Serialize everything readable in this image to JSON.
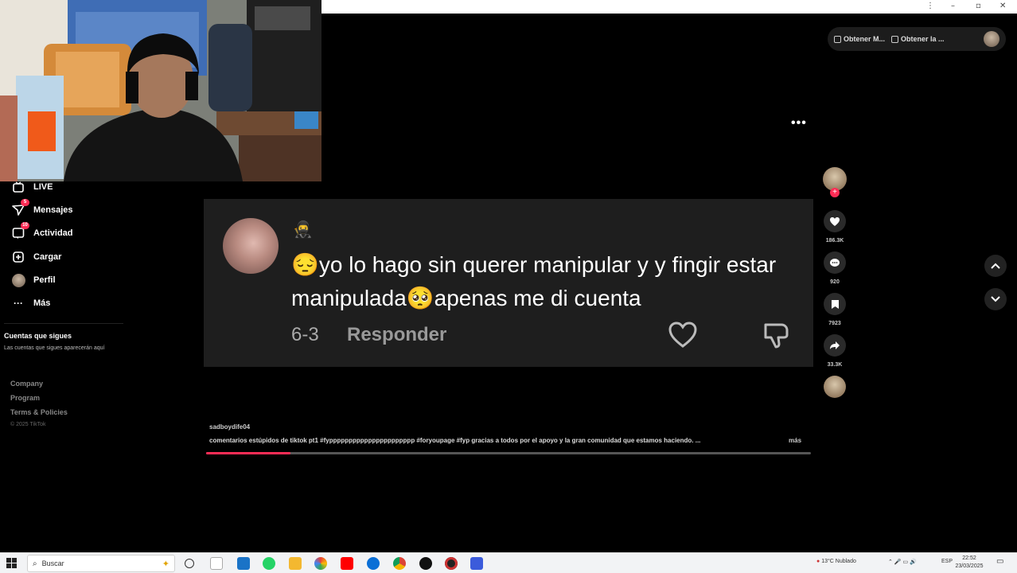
{
  "sidebar": {
    "items": [
      {
        "label": "LIVE",
        "icon": "live-icon",
        "badge": ""
      },
      {
        "label": "Mensajes",
        "icon": "messages-icon",
        "badge": "5"
      },
      {
        "label": "Actividad",
        "icon": "activity-icon",
        "badge": "10"
      },
      {
        "label": "Cargar",
        "icon": "upload-icon",
        "badge": ""
      },
      {
        "label": "Perfil",
        "icon": "profile-avatar",
        "badge": ""
      },
      {
        "label": "Más",
        "icon": "more-icon",
        "badge": ""
      }
    ],
    "following_title": "Cuentas que sigues",
    "following_sub": "Las cuentas que sigues aparecerán aquí",
    "links": [
      "Company",
      "Program",
      "Terms & Policies"
    ],
    "copyright": "© 2025 TikTok"
  },
  "top": {
    "pill1": "Obtener M...",
    "pill2": "Obtener la ..."
  },
  "comment": {
    "mini_icon": "🥷",
    "emoji1": "😔",
    "text1": "yo lo hago sin querer manipular y y fingir estar manipulada",
    "emoji2": "🥺",
    "text2": "apenas me di cuenta",
    "date": "6-3",
    "reply": "Responder"
  },
  "rail": {
    "likes": "186.3K",
    "comments": "920",
    "saves": "7923",
    "shares": "33.3K"
  },
  "caption": {
    "user": "sadboydife04",
    "text": "comentarios estúpidos de tiktok pt1 #fypppppppppppppppppppppp  #foryoupage  #fyp  gracias a todos por el apoyo y la gran comunidad que estamos haciendo. ...",
    "more": "más",
    "progress": 0.14
  },
  "taskbar": {
    "search_placeholder": "Buscar",
    "weather": "13°C  Nublado",
    "lang": "ESP",
    "time": "22:52",
    "date": "23/03/2025"
  },
  "colors": {
    "accent": "#fe2c55",
    "card_bg": "#1e1e1e"
  }
}
